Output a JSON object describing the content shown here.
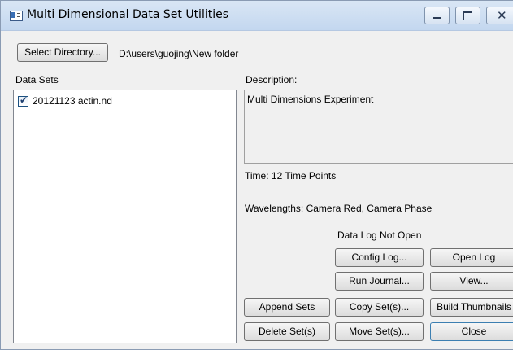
{
  "window": {
    "title": "Multi Dimensional Data Set Utilities",
    "minimize_icon": "minimize-icon",
    "maximize_icon": "maximize-icon",
    "close_icon": "close-icon"
  },
  "directory": {
    "button_label": "Select Directory...",
    "path": "D:\\users\\guojing\\New folder"
  },
  "data_sets": {
    "label": "Data Sets",
    "items": [
      {
        "label": "20121123 actin.nd",
        "checked": true
      }
    ]
  },
  "description": {
    "label": "Description:",
    "text": "Multi Dimensions Experiment"
  },
  "info": {
    "time": "Time: 12 Time Points",
    "wavelengths": "Wavelengths: Camera Red, Camera Phase",
    "log_status": "Data Log Not Open"
  },
  "buttons": {
    "config_log": "Config Log...",
    "open_log": "Open Log",
    "run_journal": "Run Journal...",
    "view": "View...",
    "append_sets": "Append Sets",
    "copy_sets": "Copy Set(s)...",
    "build_thumbnails": "Build Thumbnails",
    "delete_sets": "Delete Set(s)",
    "move_sets": "Move Set(s)...",
    "close": "Close"
  },
  "colors": {
    "titlebar": "#c3d7ef",
    "window_bg": "#f0f0f0",
    "checkbox_border": "#1c5180"
  }
}
